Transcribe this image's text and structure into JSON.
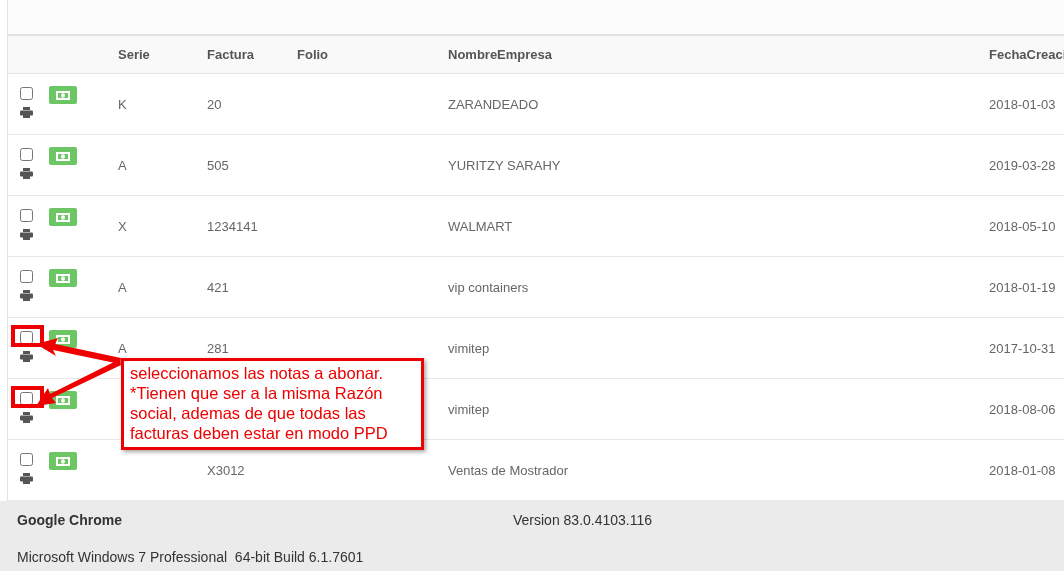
{
  "table": {
    "columns": [
      {},
      {},
      {
        "label": "Serie"
      },
      {
        "label": "Factura"
      },
      {
        "label": "Folio"
      },
      {
        "label": "NombreEmpresa"
      },
      {
        "label": "FechaCreaci"
      }
    ],
    "rows": [
      {
        "checked": false,
        "serie": "K",
        "factura": "20",
        "empresa": "ZARANDEADO",
        "fecha": "2018-01-03"
      },
      {
        "checked": false,
        "serie": "A",
        "factura": "505",
        "empresa": "YURITZY SARAHY",
        "fecha": "2019-03-28"
      },
      {
        "checked": false,
        "serie": "X",
        "factura": "1234141",
        "empresa": "WALMART",
        "fecha": "2018-05-10"
      },
      {
        "checked": false,
        "serie": "A",
        "factura": "421",
        "empresa": "vip containers",
        "fecha": "2018-01-19"
      },
      {
        "checked": false,
        "serie": "A",
        "factura": "281",
        "empresa": "vimitep",
        "fecha": "2017-10-31",
        "highlighted": true
      },
      {
        "checked": false,
        "empresa": "vimitep",
        "fecha": "2018-08-06",
        "highlighted": true
      },
      {
        "checked": false,
        "factura": "X3012",
        "empresa": "Ventas de Mostrador",
        "fecha": "2018-01-08"
      }
    ]
  },
  "callout": {
    "text": "seleccionamos las notas a abonar.\n*Tienen que ser a la misma Razón social, ademas de que todas las facturas deben estar en modo PPD"
  },
  "footer": {
    "browser": "Google Chrome",
    "version": "Version 83.0.4103.116",
    "os": "Microsoft Windows 7 Professional  64-bit Build 6.1.7601"
  }
}
